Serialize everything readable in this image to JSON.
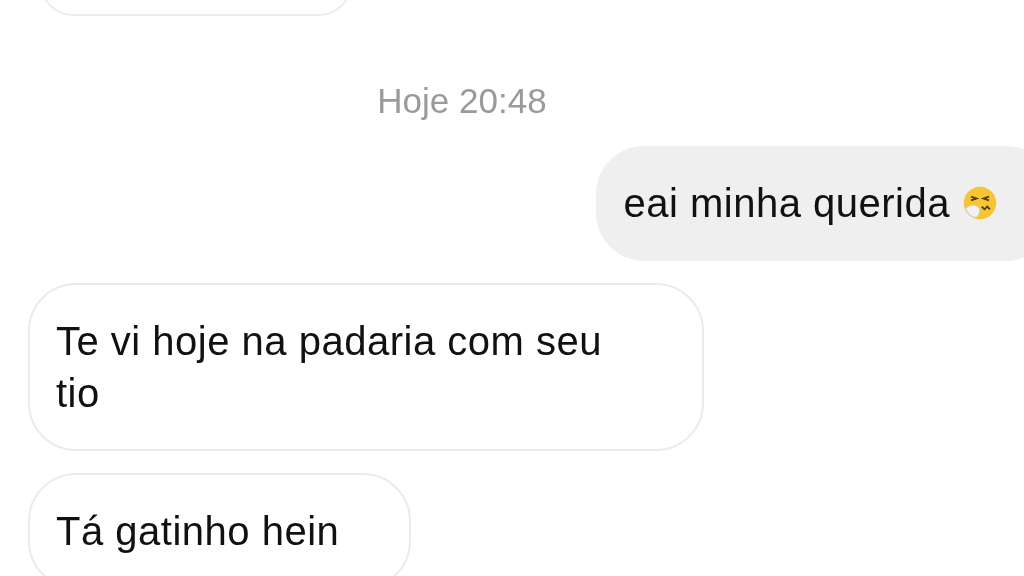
{
  "messages": [
    {
      "kind": "incoming"
    },
    {
      "kind": "timestamp",
      "text": "Hoje 20:48"
    },
    {
      "kind": "outgoing",
      "text": "eai minha querida",
      "emoji": true
    },
    {
      "kind": "incoming",
      "text": "Te vi hoje na padaria com seu tio"
    },
    {
      "kind": "incoming",
      "text": "Tá gatinho hein"
    }
  ]
}
